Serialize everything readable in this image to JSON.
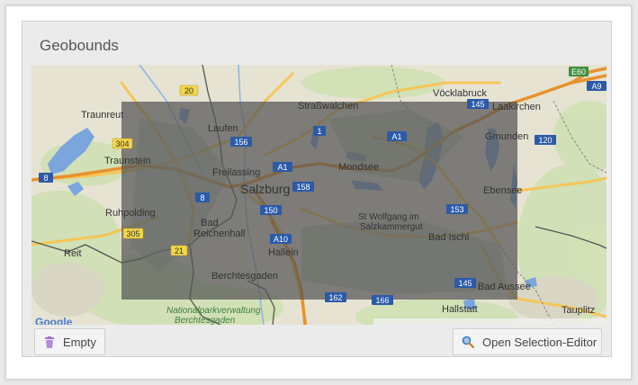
{
  "panel": {
    "title": "Geobounds"
  },
  "map": {
    "places": {
      "traunreut": "Traunreut",
      "laufen": "Laufen",
      "strasswalchen": "Straßwalchen",
      "voecklabruck": "Vöcklabruck",
      "laakirchen": "Laakirchen",
      "gmunden": "Gmunden",
      "traunstein": "Traunstein",
      "freilassing": "Freilassing",
      "salzburg": "Salzburg",
      "mondsee": "Mondsee",
      "ebensee": "Ebensee",
      "ruhpolding": "Ruhpolding",
      "bad_reichenhall_1": "Bad",
      "bad_reichenhall_2": "Reichenhall",
      "st_wolfgang_1": "St Wolfgang im",
      "st_wolfgang_2": "Salzkammergut",
      "bad_ischl": "Bad Ischl",
      "reit": "Reit",
      "hallein": "Hallein",
      "berchtesgaden": "Berchtesgaden",
      "bad_aussee": "Bad Aussee",
      "np_1": "Nationalparkverwaltung",
      "np_2": "Berchtesgaden",
      "hallstatt": "Hallstatt",
      "tauplitz": "Tauplitz"
    },
    "shields": {
      "e60": "E60",
      "a9": "A9",
      "r20": "20",
      "r145a": "145",
      "r304": "304",
      "r156": "156",
      "r1": "1",
      "a1a": "A1",
      "r120": "120",
      "a1b": "A1",
      "r8a": "8",
      "r8b": "8",
      "r158": "158",
      "r150": "150",
      "r153": "153",
      "r305": "305",
      "a10": "A10",
      "r21": "21",
      "r145b": "145",
      "r162": "162",
      "r166": "166"
    },
    "google_logo": "Google"
  },
  "buttons": {
    "empty_label": "Empty",
    "editor_label": "Open Selection-Editor"
  }
}
